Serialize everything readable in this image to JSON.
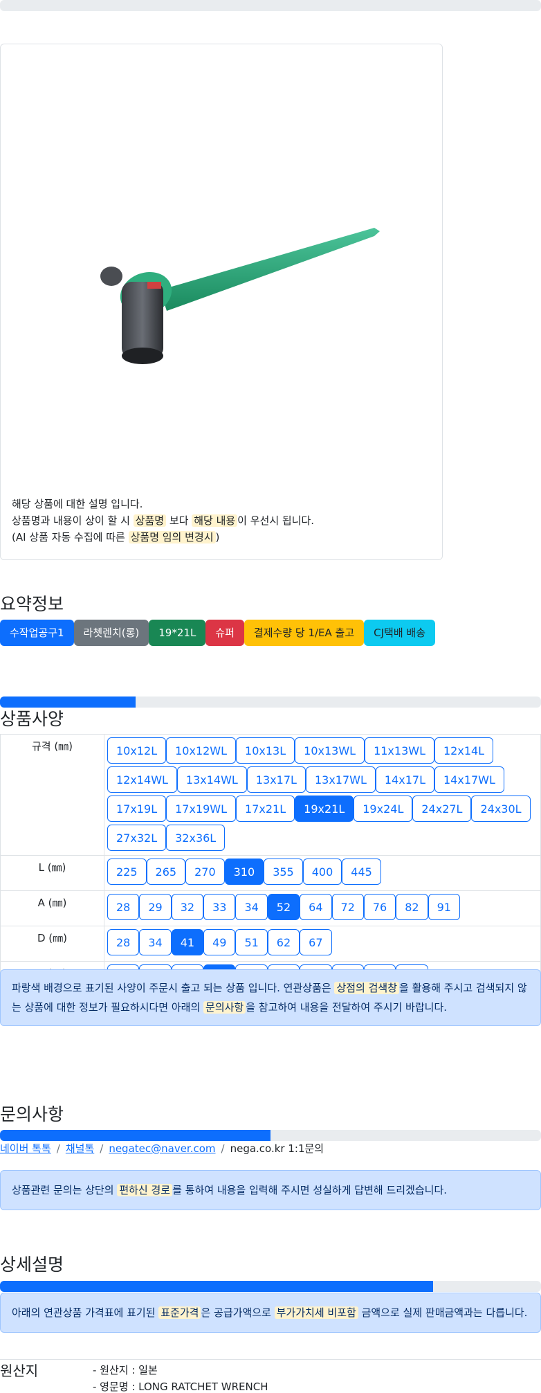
{
  "product": {
    "description_line1": "해당 상품에 대한 설명 입니다.",
    "description_line2_a": "상품명과 내용이 상이 할 시 ",
    "description_line2_hl1": "상품명",
    "description_line2_b": " 보다 ",
    "description_line2_hl2": "해당 내용",
    "description_line2_c": "이 우선시 됩니다.",
    "description_line3_a": "(AI 상품 자동 수집에 따른 ",
    "description_line3_hl": "상품명 임의 변경시",
    "description_line3_b": ")"
  },
  "summary": {
    "title": "요약정보",
    "badges": [
      {
        "label": "수작업공구1",
        "color": "#0d6efd"
      },
      {
        "label": "라쳇렌치(롱)",
        "color": "#6c757d"
      },
      {
        "label": "19*21L",
        "color": "#198754"
      },
      {
        "label": "슈퍼",
        "color": "#dc3545"
      },
      {
        "label": "결제수량 당 1/EA 출고",
        "color": "#ffc107"
      },
      {
        "label": "CJ택배 배송",
        "color": "#0dcaf0"
      }
    ]
  },
  "specs": {
    "title": "상품사양",
    "progress": 0.25,
    "rows": [
      {
        "label": "규격 (㎜)",
        "options": [
          "10x12L",
          "10x12WL",
          "10x13L",
          "10x13WL",
          "11x13WL",
          "12x14L",
          "12x14WL",
          "13x14WL",
          "13x17L",
          "13x17WL",
          "14x17L",
          "14x17WL",
          "17x19L",
          "17x19WL",
          "17x21L",
          "19x21L",
          "19x24L",
          "24x27L",
          "24x30L",
          "27x32L",
          "32x36L"
        ],
        "selected": "19x21L"
      },
      {
        "label": "L (㎜)",
        "options": [
          "225",
          "265",
          "270",
          "310",
          "355",
          "400",
          "445"
        ],
        "selected": "310"
      },
      {
        "label": "A (㎜)",
        "options": [
          "28",
          "29",
          "32",
          "33",
          "34",
          "52",
          "64",
          "72",
          "76",
          "82",
          "91"
        ],
        "selected": "52"
      },
      {
        "label": "D (㎜)",
        "options": [
          "28",
          "34",
          "41",
          "49",
          "51",
          "62",
          "67"
        ],
        "selected": "41"
      },
      {
        "label": "S (㎜)",
        "options": [
          "10",
          "11",
          "14",
          "16",
          "18",
          "20",
          "21",
          "32",
          "33",
          "34"
        ],
        "selected": "16"
      }
    ],
    "notice_a": "파랑색 배경으로 표기된 사양이 주문시 출고 되는 상품 입니다. 연관상품은 ",
    "notice_hl1": "상점의 검색창",
    "notice_b": "을 활용해 주시고 검색되지 않는 상품에 대한 정보가 필요하시다면 아래의 ",
    "notice_hl2": "문의사항",
    "notice_c": "을 참고하여 내용을 전달하여 주시기 바랍니다."
  },
  "inquiry": {
    "title": "문의사항",
    "progress": 0.5,
    "links": [
      "네이버 톡톡",
      "채널톡",
      "negatec@naver.com"
    ],
    "plain_link": "nega.co.kr 1:1문의",
    "sep": "/",
    "notice_a": "상품관련 문의는 상단의 ",
    "notice_hl": "편하신 경로",
    "notice_b": "를 통하여 내용을 입력해 주시면 성실하게 답변해 드리겠습니다."
  },
  "detail": {
    "title": "상세설명",
    "progress": 0.8,
    "notice_a": "아래의 연관상품 가격표에 표기된 ",
    "notice_hl1": "표준가격",
    "notice_b": "은 공급가액으로 ",
    "notice_hl2": "부가가치세 비포함",
    "notice_c": " 금액으로 실제 판매금액과는 다릅니다."
  },
  "origin": {
    "title": "원산지",
    "items": [
      "- 원산지 : 일본",
      "- 영문명 : LONG RATCHET WRENCH"
    ]
  }
}
